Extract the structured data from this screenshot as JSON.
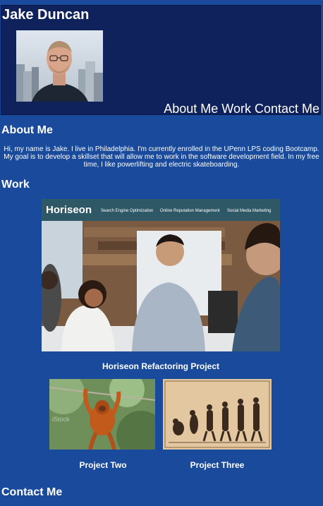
{
  "header": {
    "name": "Jake Duncan",
    "nav": [
      "About Me",
      "Work",
      "Contact Me"
    ]
  },
  "about": {
    "title": "About Me",
    "text": "Hi, my name is Jake. I live in Philadelphia. I'm currently enrolled in the UPenn LPS coding Bootcamp. My goal is to develop a skillset that will allow me to work in the software development field. In my free time, I like powerlifting and electric skateboarding."
  },
  "work": {
    "title": "Work",
    "horiseon_banner": {
      "logo": "Horiseon",
      "links": [
        "Search Engine Optimization",
        "Online Reputation Management",
        "Social Media Marketing"
      ]
    },
    "projects": [
      {
        "caption": "Horiseon Refactoring Project"
      },
      {
        "caption": "Project Two",
        "watermark": "iStock"
      },
      {
        "caption": "Project Three"
      }
    ]
  },
  "contact": {
    "title": "Contact Me"
  },
  "colors": {
    "page_bg": "#194a9b",
    "header_bg": "#10225b",
    "text": "#ffffff"
  }
}
